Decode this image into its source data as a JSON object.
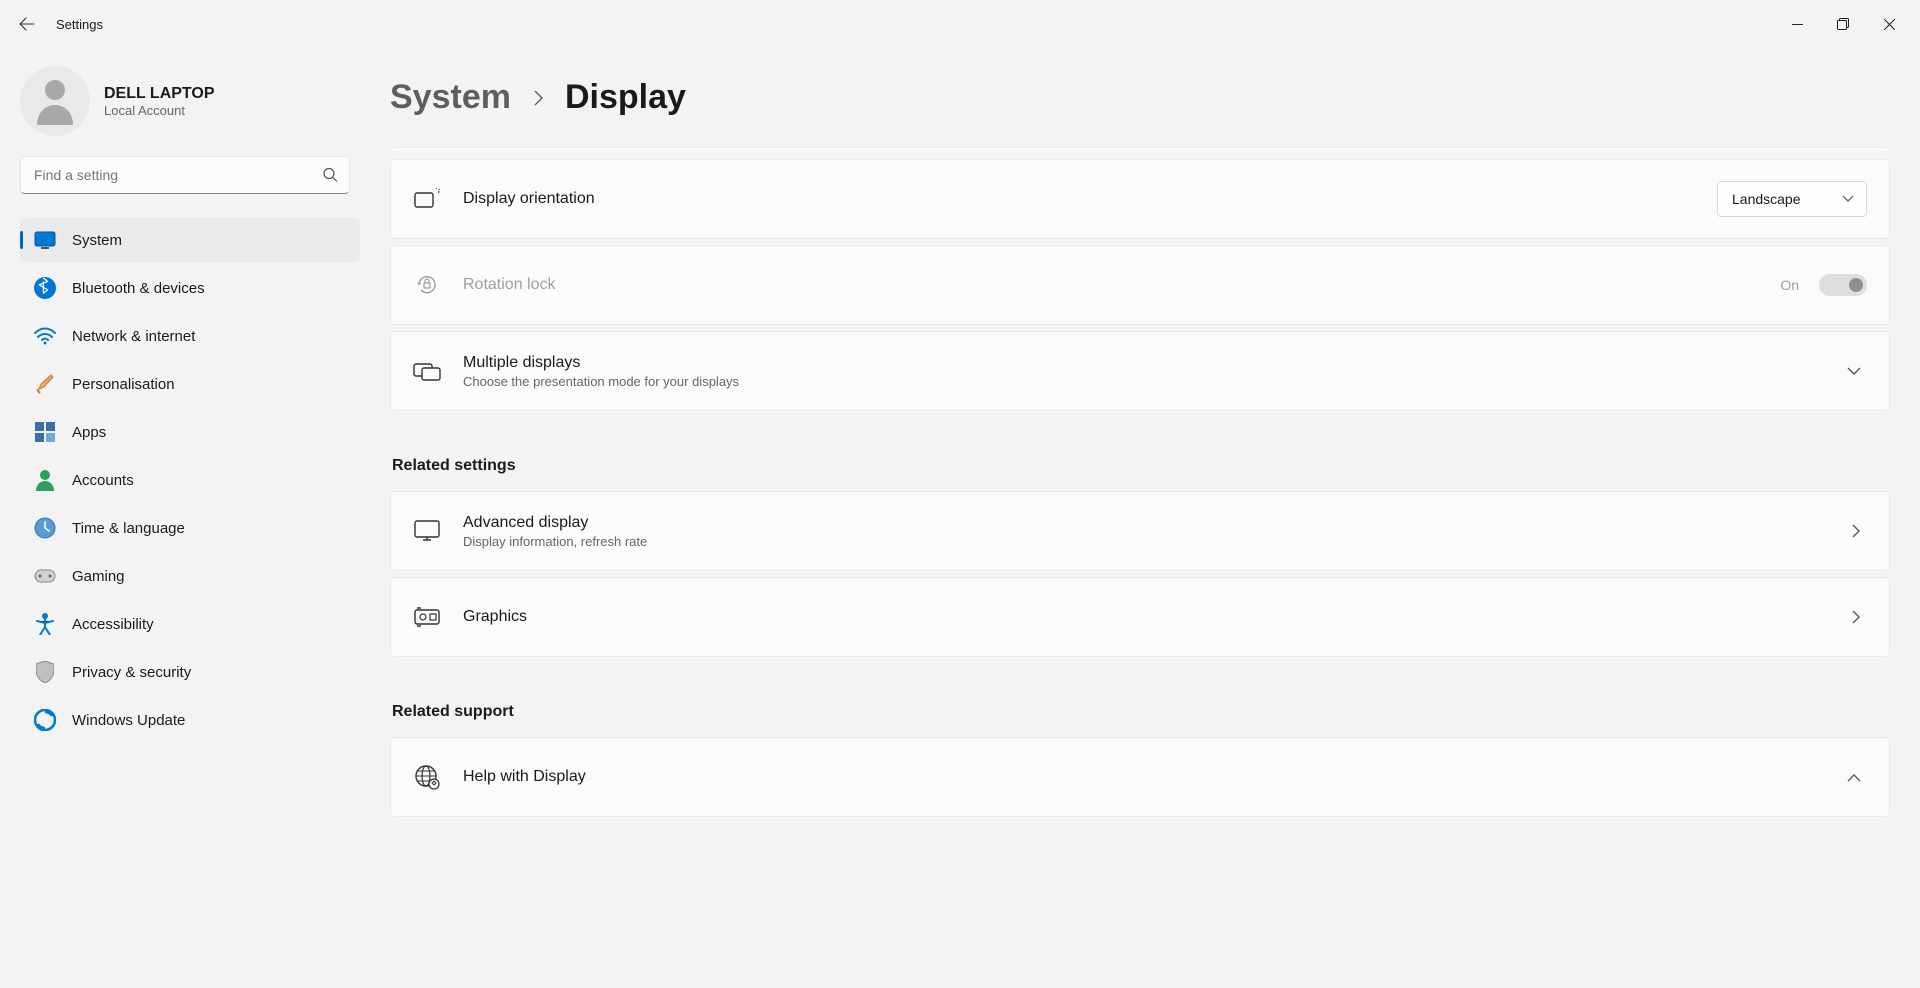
{
  "window": {
    "title": "Settings"
  },
  "profile": {
    "name": "DELL LAPTOP",
    "subtitle": "Local Account"
  },
  "search": {
    "placeholder": "Find a setting"
  },
  "nav": {
    "items": [
      {
        "label": "System",
        "icon": "💻",
        "active": true
      },
      {
        "label": "Bluetooth & devices",
        "icon": "bt"
      },
      {
        "label": "Network & internet",
        "icon": "📶"
      },
      {
        "label": "Personalisation",
        "icon": "🖌️"
      },
      {
        "label": "Apps",
        "icon": "apps"
      },
      {
        "label": "Accounts",
        "icon": "👤"
      },
      {
        "label": "Time & language",
        "icon": "🕒"
      },
      {
        "label": "Gaming",
        "icon": "🎮"
      },
      {
        "label": "Accessibility",
        "icon": "acc"
      },
      {
        "label": "Privacy & security",
        "icon": "🛡️"
      },
      {
        "label": "Windows Update",
        "icon": "🔄"
      }
    ]
  },
  "breadcrumb": {
    "parent": "System",
    "current": "Display"
  },
  "settings": {
    "orientation": {
      "label": "Display orientation",
      "value": "Landscape"
    },
    "rotation": {
      "label": "Rotation lock",
      "state_label": "On"
    },
    "multi": {
      "label": "Multiple displays",
      "sub": "Choose the presentation mode for your displays"
    }
  },
  "related_settings": {
    "heading": "Related settings",
    "advanced": {
      "label": "Advanced display",
      "sub": "Display information, refresh rate"
    },
    "graphics": {
      "label": "Graphics"
    }
  },
  "related_support": {
    "heading": "Related support",
    "help": {
      "label": "Help with Display"
    }
  }
}
